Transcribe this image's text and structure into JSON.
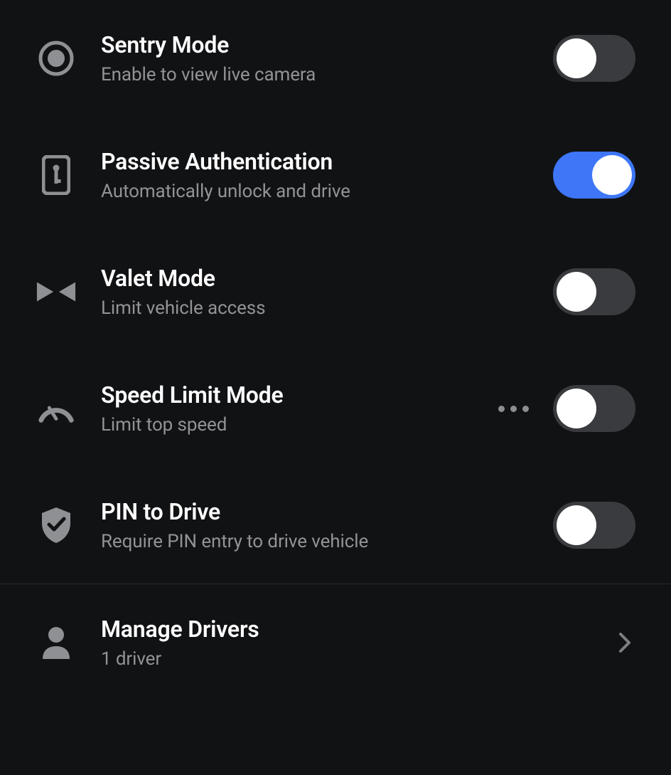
{
  "settings": [
    {
      "key": "sentry",
      "title": "Sentry Mode",
      "subtitle": "Enable to view live camera",
      "toggle": "off",
      "more": false
    },
    {
      "key": "passive",
      "title": "Passive Authentication",
      "subtitle": "Automatically unlock and drive",
      "toggle": "on",
      "more": false
    },
    {
      "key": "valet",
      "title": "Valet Mode",
      "subtitle": "Limit vehicle access",
      "toggle": "off",
      "more": false
    },
    {
      "key": "speed",
      "title": "Speed Limit Mode",
      "subtitle": "Limit top speed",
      "toggle": "off",
      "more": true
    },
    {
      "key": "pin",
      "title": "PIN to Drive",
      "subtitle": "Require PIN entry to drive vehicle",
      "toggle": "off",
      "more": false
    }
  ],
  "manage": {
    "title": "Manage Drivers",
    "subtitle": "1 driver"
  }
}
